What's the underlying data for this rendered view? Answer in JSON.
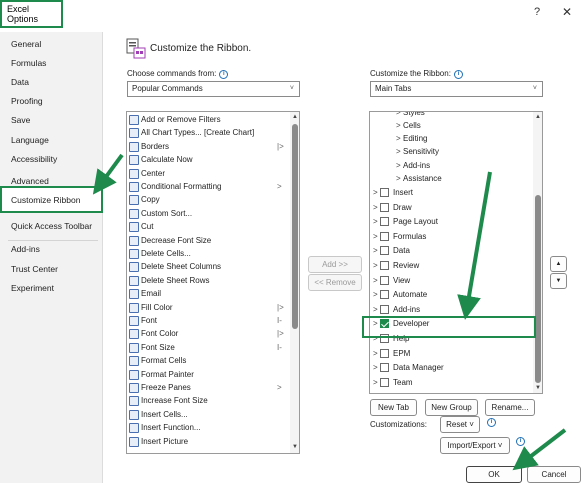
{
  "window": {
    "title": "Excel Options",
    "help": "?",
    "close": "✕"
  },
  "nav": {
    "items": [
      "General",
      "Formulas",
      "Data",
      "Proofing",
      "Save",
      "Language",
      "Accessibility",
      "Advanced"
    ],
    "selected": "Customize Ribbon",
    "items_after": [
      "Quick Access Toolbar"
    ],
    "items_lower": [
      "Add-ins",
      "Trust Center",
      "Experiment"
    ]
  },
  "header": {
    "title": "Customize the Ribbon."
  },
  "left_panel": {
    "label_pre": "Choose commands from:",
    "select_value": "Popular Commands",
    "commands": [
      {
        "label": "Add or Remove Filters",
        "sub": ""
      },
      {
        "label": "All Chart Types... [Create Chart]",
        "sub": ""
      },
      {
        "label": "Borders",
        "sub": "|>"
      },
      {
        "label": "Calculate Now",
        "sub": ""
      },
      {
        "label": "Center",
        "sub": ""
      },
      {
        "label": "Conditional Formatting",
        "sub": ">"
      },
      {
        "label": "Copy",
        "sub": ""
      },
      {
        "label": "Custom Sort...",
        "sub": ""
      },
      {
        "label": "Cut",
        "sub": ""
      },
      {
        "label": "Decrease Font Size",
        "sub": ""
      },
      {
        "label": "Delete Cells...",
        "sub": ""
      },
      {
        "label": "Delete Sheet Columns",
        "sub": ""
      },
      {
        "label": "Delete Sheet Rows",
        "sub": ""
      },
      {
        "label": "Email",
        "sub": ""
      },
      {
        "label": "Fill Color",
        "sub": "|>"
      },
      {
        "label": "Font",
        "sub": "I-"
      },
      {
        "label": "Font Color",
        "sub": "|>"
      },
      {
        "label": "Font Size",
        "sub": "I-"
      },
      {
        "label": "Format Cells",
        "sub": ""
      },
      {
        "label": "Format Painter",
        "sub": ""
      },
      {
        "label": "Freeze Panes",
        "sub": ">"
      },
      {
        "label": "Increase Font Size",
        "sub": ""
      },
      {
        "label": "Insert Cells...",
        "sub": ""
      },
      {
        "label": "Insert Function...",
        "sub": ""
      },
      {
        "label": "Insert Picture",
        "sub": ""
      }
    ]
  },
  "middle": {
    "add": "Add >>",
    "remove": "<< Remove"
  },
  "right_panel": {
    "label": "Customize the Ribbon:",
    "select_value": "Main Tabs",
    "top_partial": "Styles",
    "subgroups": [
      "Cells",
      "Editing",
      "Sensitivity",
      "Add-ins",
      "Assistance"
    ],
    "tabs": [
      {
        "label": "Insert",
        "checked": false
      },
      {
        "label": "Draw",
        "checked": false
      },
      {
        "label": "Page Layout",
        "checked": false
      },
      {
        "label": "Formulas",
        "checked": false
      },
      {
        "label": "Data",
        "checked": false
      },
      {
        "label": "Review",
        "checked": false
      },
      {
        "label": "View",
        "checked": false
      },
      {
        "label": "Automate",
        "checked": false
      },
      {
        "label": "Add-ins",
        "checked": false
      },
      {
        "label": "Developer",
        "checked": true
      },
      {
        "label": "Help",
        "checked": false
      },
      {
        "label": "EPM",
        "checked": false
      },
      {
        "label": "Data Manager",
        "checked": false
      },
      {
        "label": "Team",
        "checked": false
      }
    ],
    "new_tab": "New Tab",
    "new_group": "New Group",
    "rename": "Rename...",
    "customizations_label": "Customizations:",
    "reset": "Reset ˅",
    "import_export": "Import/Export ˅"
  },
  "footer": {
    "ok": "OK",
    "cancel": "Cancel"
  },
  "colors": {
    "highlight_green": "#1e8a4c",
    "info_blue": "#1f6fb8"
  },
  "icons": [
    "customize-ribbon-icon",
    "info-icon",
    "scroll-up-icon",
    "scroll-down-icon",
    "move-up-icon",
    "move-down-icon",
    "chevron-down-icon",
    "expand-arrow-icon",
    "checkbox-icon"
  ]
}
